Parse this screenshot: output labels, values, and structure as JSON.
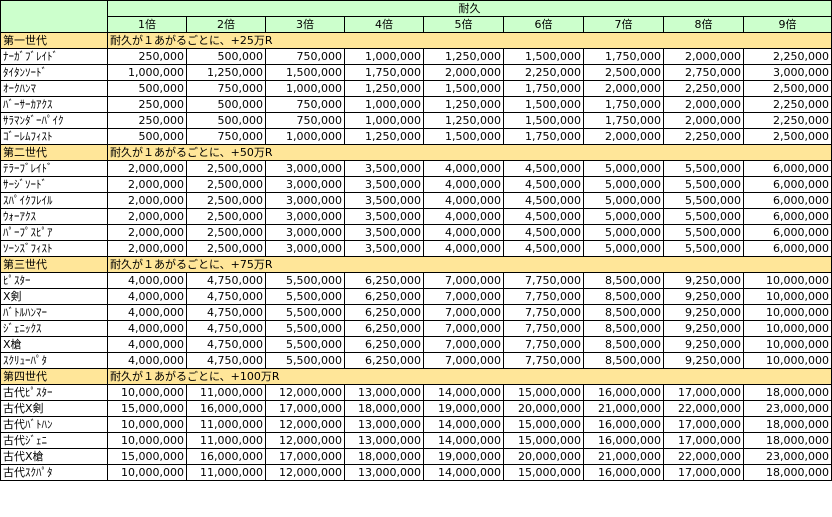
{
  "header": {
    "group_label": "耐久",
    "multipliers": [
      "1倍",
      "2倍",
      "3倍",
      "4倍",
      "5倍",
      "6倍",
      "7倍",
      "8倍",
      "9倍"
    ]
  },
  "sections": [
    {
      "name": "第一世代",
      "note": "耐久が１あがるごとに、+25万R",
      "rows": [
        {
          "name": "ﾅｰｶﾞﾌﾞﾚｲﾄﾞ",
          "values": [
            "250,000",
            "500,000",
            "750,000",
            "1,000,000",
            "1,250,000",
            "1,500,000",
            "1,750,000",
            "2,000,000",
            "2,250,000"
          ]
        },
        {
          "name": "ﾀｲﾀﾝｿｰﾄﾞ",
          "values": [
            "1,000,000",
            "1,250,000",
            "1,500,000",
            "1,750,000",
            "2,000,000",
            "2,250,000",
            "2,500,000",
            "2,750,000",
            "3,000,000"
          ]
        },
        {
          "name": "ｵｰｸﾊﾝﾏ",
          "values": [
            "500,000",
            "750,000",
            "1,000,000",
            "1,250,000",
            "1,500,000",
            "1,750,000",
            "2,000,000",
            "2,250,000",
            "2,500,000"
          ]
        },
        {
          "name": "ﾊﾞｰｻｰｶｱｸｽ",
          "values": [
            "250,000",
            "500,000",
            "750,000",
            "1,000,000",
            "1,250,000",
            "1,500,000",
            "1,750,000",
            "2,000,000",
            "2,250,000"
          ]
        },
        {
          "name": "ｻﾗﾏﾝﾀﾞｰﾊﾟｲｸ",
          "values": [
            "250,000",
            "500,000",
            "750,000",
            "1,000,000",
            "1,250,000",
            "1,500,000",
            "1,750,000",
            "2,000,000",
            "2,250,000"
          ]
        },
        {
          "name": "ｺﾞｰﾚﾑﾌｨｽﾄ",
          "values": [
            "500,000",
            "750,000",
            "1,000,000",
            "1,250,000",
            "1,500,000",
            "1,750,000",
            "2,000,000",
            "2,250,000",
            "2,500,000"
          ]
        }
      ]
    },
    {
      "name": "第二世代",
      "note": "耐久が１あがるごとに、+50万R",
      "rows": [
        {
          "name": "ﾃﾗｰﾌﾞﾚｲﾄﾞ",
          "values": [
            "2,000,000",
            "2,500,000",
            "3,000,000",
            "3,500,000",
            "4,000,000",
            "4,500,000",
            "5,000,000",
            "5,500,000",
            "6,000,000"
          ]
        },
        {
          "name": "ｻｰｼﾞｿｰﾄﾞ",
          "values": [
            "2,000,000",
            "2,500,000",
            "3,000,000",
            "3,500,000",
            "4,000,000",
            "4,500,000",
            "5,000,000",
            "5,500,000",
            "6,000,000"
          ]
        },
        {
          "name": "ｽﾊﾟｲｸﾌﾚｲﾙ",
          "values": [
            "2,000,000",
            "2,500,000",
            "3,000,000",
            "3,500,000",
            "4,000,000",
            "4,500,000",
            "5,000,000",
            "5,500,000",
            "6,000,000"
          ]
        },
        {
          "name": "ｳｫｰｱｸｽ",
          "values": [
            "2,000,000",
            "2,500,000",
            "3,000,000",
            "3,500,000",
            "4,000,000",
            "4,500,000",
            "5,000,000",
            "5,500,000",
            "6,000,000"
          ]
        },
        {
          "name": "ﾊﾟｰﾌﾟｽﾋﾟｱ",
          "values": [
            "2,000,000",
            "2,500,000",
            "3,000,000",
            "3,500,000",
            "4,000,000",
            "4,500,000",
            "5,000,000",
            "5,500,000",
            "6,000,000"
          ]
        },
        {
          "name": "ｿｰﾝｽﾞﾌｨｽﾄ",
          "values": [
            "2,000,000",
            "2,500,000",
            "3,000,000",
            "3,500,000",
            "4,000,000",
            "4,500,000",
            "5,000,000",
            "5,500,000",
            "6,000,000"
          ]
        }
      ]
    },
    {
      "name": "第三世代",
      "note": "耐久が１あがるごとに、+75万R",
      "rows": [
        {
          "name": "ﾋﾟｽﾀｰ",
          "values": [
            "4,000,000",
            "4,750,000",
            "5,500,000",
            "6,250,000",
            "7,000,000",
            "7,750,000",
            "8,500,000",
            "9,250,000",
            "10,000,000"
          ]
        },
        {
          "name": "X剣",
          "values": [
            "4,000,000",
            "4,750,000",
            "5,500,000",
            "6,250,000",
            "7,000,000",
            "7,750,000",
            "8,500,000",
            "9,250,000",
            "10,000,000"
          ]
        },
        {
          "name": "ﾊﾞﾄﾙﾊﾝﾏｰ",
          "values": [
            "4,000,000",
            "4,750,000",
            "5,500,000",
            "6,250,000",
            "7,000,000",
            "7,750,000",
            "8,500,000",
            "9,250,000",
            "10,000,000"
          ]
        },
        {
          "name": "ｼﾞｪﾆｯｸｽ",
          "values": [
            "4,000,000",
            "4,750,000",
            "5,500,000",
            "6,250,000",
            "7,000,000",
            "7,750,000",
            "8,500,000",
            "9,250,000",
            "10,000,000"
          ]
        },
        {
          "name": "X槍",
          "values": [
            "4,000,000",
            "4,750,000",
            "5,500,000",
            "6,250,000",
            "7,000,000",
            "7,750,000",
            "8,500,000",
            "9,250,000",
            "10,000,000"
          ]
        },
        {
          "name": "ｽｸﾘｭｰﾊﾟﾀ",
          "values": [
            "4,000,000",
            "4,750,000",
            "5,500,000",
            "6,250,000",
            "7,000,000",
            "7,750,000",
            "8,500,000",
            "9,250,000",
            "10,000,000"
          ]
        }
      ]
    },
    {
      "name": "第四世代",
      "note": "耐久が１あがるごとに、+100万R",
      "rows": [
        {
          "name": "古代ﾋﾟｽﾀｰ",
          "values": [
            "10,000,000",
            "11,000,000",
            "12,000,000",
            "13,000,000",
            "14,000,000",
            "15,000,000",
            "16,000,000",
            "17,000,000",
            "18,000,000"
          ]
        },
        {
          "name": "古代X剣",
          "values": [
            "15,000,000",
            "16,000,000",
            "17,000,000",
            "18,000,000",
            "19,000,000",
            "20,000,000",
            "21,000,000",
            "22,000,000",
            "23,000,000"
          ]
        },
        {
          "name": "古代ﾊﾞﾄﾊﾝ",
          "values": [
            "10,000,000",
            "11,000,000",
            "12,000,000",
            "13,000,000",
            "14,000,000",
            "15,000,000",
            "16,000,000",
            "17,000,000",
            "18,000,000"
          ]
        },
        {
          "name": "古代ｼﾞｪﾆ",
          "values": [
            "10,000,000",
            "11,000,000",
            "12,000,000",
            "13,000,000",
            "14,000,000",
            "15,000,000",
            "16,000,000",
            "17,000,000",
            "18,000,000"
          ]
        },
        {
          "name": "古代X槍",
          "values": [
            "15,000,000",
            "16,000,000",
            "17,000,000",
            "18,000,000",
            "19,000,000",
            "20,000,000",
            "21,000,000",
            "22,000,000",
            "23,000,000"
          ]
        },
        {
          "name": "古代ｽｸﾊﾟﾀ",
          "values": [
            "10,000,000",
            "11,000,000",
            "12,000,000",
            "13,000,000",
            "14,000,000",
            "15,000,000",
            "16,000,000",
            "17,000,000",
            "18,000,000"
          ]
        }
      ]
    }
  ]
}
